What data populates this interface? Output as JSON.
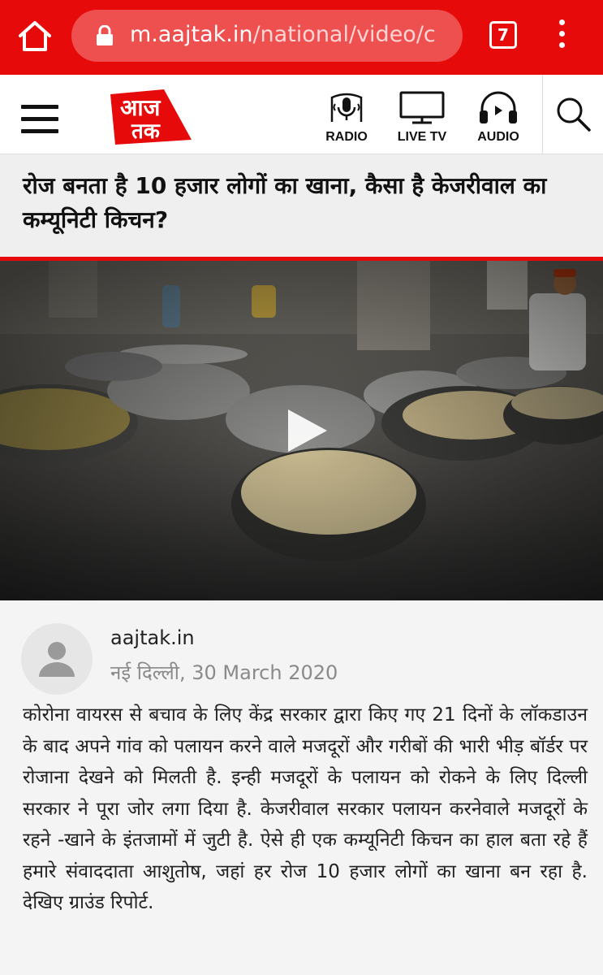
{
  "browser": {
    "url_host": "m.aajtak.in",
    "url_path": "/national/video/c",
    "tab_count": "7"
  },
  "site": {
    "logo_line1": "आज",
    "logo_line2": "तक",
    "nav": {
      "radio": "RADIO",
      "live_tv": "LIVE TV",
      "audio": "AUDIO"
    }
  },
  "article": {
    "headline": "रोज बनता है 10 हजार लोगों का खाना, कैसा है केजरीवाल का कम्यूनिटी किचन?",
    "author": "aajtak.in",
    "dateline": "नई दिल्ली, 30 March 2020",
    "body": "कोरोना वायरस से बचाव के लिए केंद्र सरकार द्वारा किए गए 21 दिनों के लॉकडाउन के बाद अपने गांव को पलायन करने वाले मजदूरों और गरीबों की भारी भीड़ बॉर्डर पर रोजाना देखने को मिलती है. इन्ही मजदूरों के पलायन को रोकने के लिए दिल्ली सरकार ने पूरा जोर लगा दिया है. केजरीवाल सरकार पलायन करनेवाले मजदूरों के रहने -खाने के इंतजामों में जुटी है. ऐसे ही एक कम्यूनिटी किचन का हाल बता रहे हैं हमारे संवाददाता आशुतोष, जहां हर रोज 10 हजार लोगों का खाना बन रहा है. देखिए ग्राउंड रिपोर्ट."
  },
  "colors": {
    "brand_red": "#e60a0a",
    "date_gray": "#8a8a8a"
  },
  "icons": [
    "home-icon",
    "lock-icon",
    "tabs-icon",
    "more-vert-icon",
    "hamburger-icon",
    "radio-icon",
    "tv-icon",
    "headphones-icon",
    "search-icon",
    "play-icon",
    "person-icon"
  ]
}
